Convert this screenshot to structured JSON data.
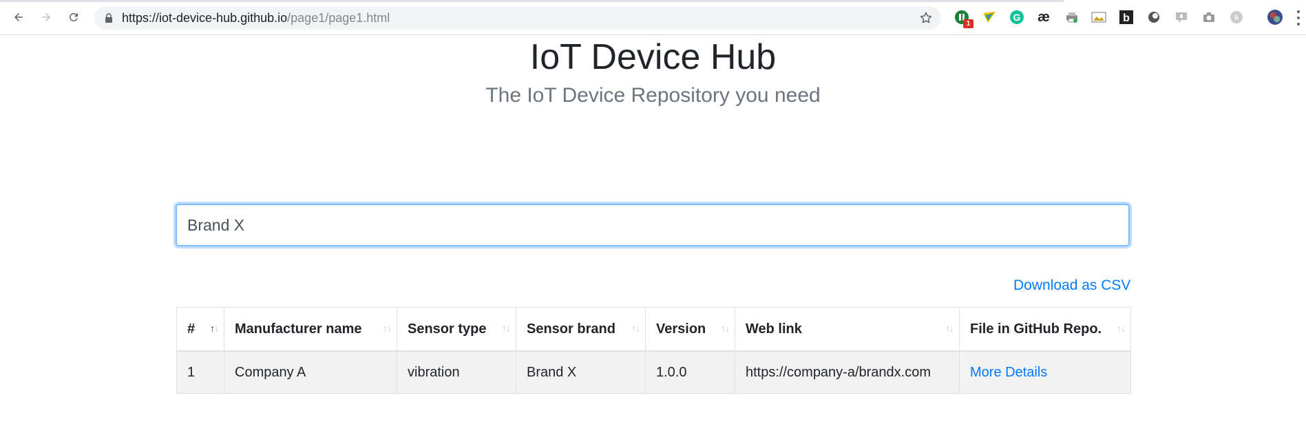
{
  "browser": {
    "url_host": "https://iot-device-hub.github.io",
    "url_path": "/page1/page1.html",
    "extension_badge": "1",
    "extensions": [
      "circle-extension-icon",
      "ribbon-extension-icon",
      "grammarly-icon",
      "ae-extension-icon",
      "printer-extension-icon",
      "image-extension-icon",
      "b-extension-icon",
      "circle-dark-extension-icon",
      "chat-extension-icon",
      "camera-extension-icon",
      "h-extension-icon",
      "avatar-extension-icon"
    ]
  },
  "page": {
    "title": "IoT Device Hub",
    "subtitle": "The IoT Device Repository you need"
  },
  "search": {
    "value": "Brand X"
  },
  "download_csv_label": "Download as CSV",
  "table": {
    "columns": [
      "#",
      "Manufacturer name",
      "Sensor type",
      "Sensor brand",
      "Version",
      "Web link",
      "File in GitHub Repo."
    ],
    "rows": [
      {
        "index": "1",
        "manufacturer": "Company A",
        "sensor_type": "vibration",
        "sensor_brand": "Brand X",
        "version": "1.0.0",
        "web_link": "https://company-a/brandx.com",
        "file_link": "More Details"
      }
    ]
  },
  "colors": {
    "accent": "#007bff",
    "focus_border": "#80bdff",
    "row_bg": "#f2f2f2"
  }
}
